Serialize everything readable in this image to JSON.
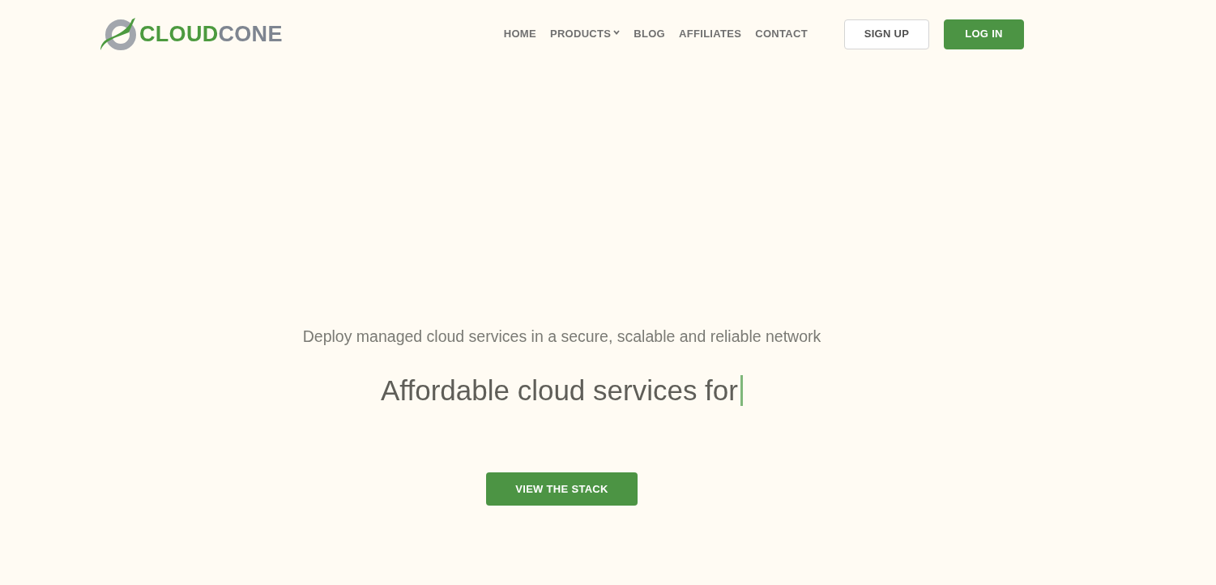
{
  "header": {
    "logo": {
      "parts": [
        {
          "text": "CLOUD",
          "kind": "accent"
        },
        {
          "text": "CONE",
          "kind": "plain"
        }
      ]
    },
    "nav": [
      {
        "label": "HOME",
        "dropdown": false
      },
      {
        "label": "PRODUCTS",
        "dropdown": true
      },
      {
        "label": "BLOG",
        "dropdown": false
      },
      {
        "label": "AFFILIATES",
        "dropdown": false
      },
      {
        "label": "CONTACT",
        "dropdown": false
      }
    ],
    "buttons": [
      {
        "label": "SIGN UP",
        "kind": "outline"
      },
      {
        "label": "LOG IN",
        "kind": "solid"
      }
    ]
  },
  "hero": {
    "subtitle": "Deploy managed cloud services in a secure, scalable and reliable network",
    "headline": "Affordable cloud services for",
    "button": "VIEW THE STACK"
  }
}
